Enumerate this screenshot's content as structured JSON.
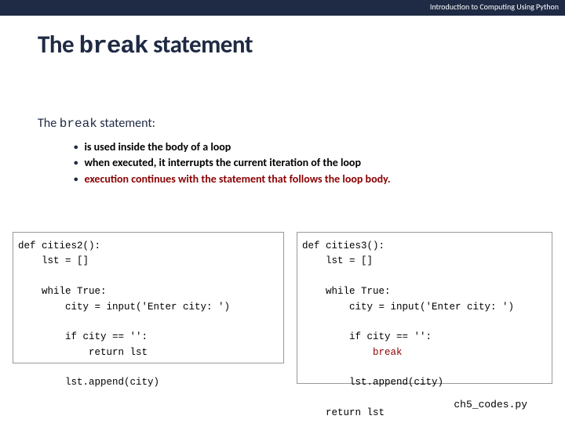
{
  "topbar": {
    "course": "Introduction to Computing Using Python"
  },
  "title": {
    "pre": "The ",
    "kw": "break",
    "post": " statement"
  },
  "subtitle": {
    "pre": "The ",
    "kw": "break",
    "post": " statement:"
  },
  "bullets": {
    "b1": "is used inside the body of a loop",
    "b2": "when executed, it interrupts the current iteration of the loop",
    "b3": "execution continues with the statement that follows the loop body."
  },
  "code_left": {
    "l0": "def cities2():",
    "l1": "    lst = []",
    "l2": "",
    "l3": "    while True:",
    "l4": "        city = input('Enter city: ')",
    "l5": "",
    "l6": "        if city == '':",
    "l7": "            return lst",
    "l8": "",
    "l9": "        lst.append(city)"
  },
  "code_right": {
    "l0": "def cities3():",
    "l1": "    lst = []",
    "l2": "",
    "l3": "    while True:",
    "l4": "        city = input('Enter city: ')",
    "l5": "",
    "l6": "        if city == '':",
    "l7a": "            ",
    "l7b": "break",
    "l8": "",
    "l9": "        lst.append(city)",
    "l10": "",
    "l11": "    return lst"
  },
  "footer": {
    "filename": "ch5_codes.py"
  }
}
